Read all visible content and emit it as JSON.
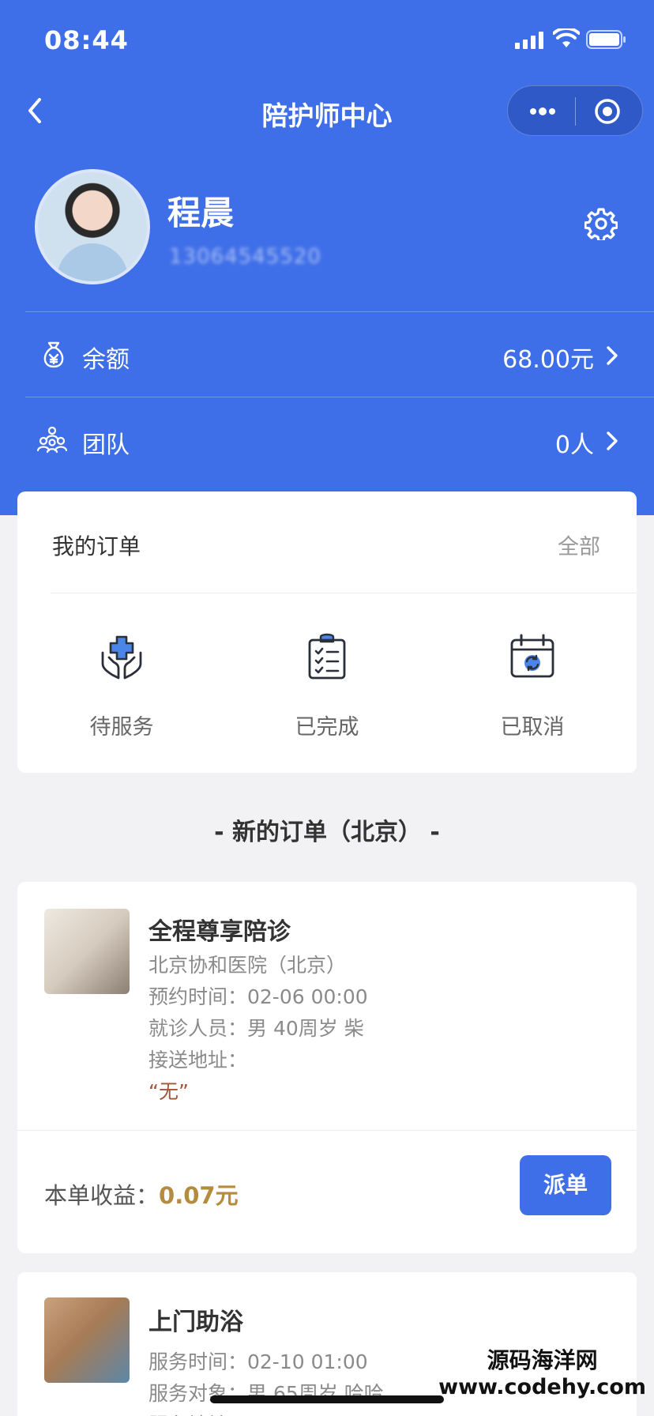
{
  "status_bar": {
    "time": "08:44"
  },
  "nav": {
    "title": "陪护师中心"
  },
  "profile": {
    "name": "程晨",
    "phone": "13064545520"
  },
  "rows": [
    {
      "icon": "money-bag-icon",
      "label": "余额",
      "value": "68.00元"
    },
    {
      "icon": "team-icon",
      "label": "团队",
      "value": "0人"
    }
  ],
  "my_orders": {
    "title": "我的订单",
    "all_label": "全部",
    "categories": [
      {
        "icon": "care-hands-icon",
        "label": "待服务"
      },
      {
        "icon": "clipboard-check-icon",
        "label": "已完成"
      },
      {
        "icon": "calendar-refresh-icon",
        "label": "已取消"
      }
    ]
  },
  "new_orders": {
    "section_title": "- 新的订单（北京） -",
    "orders": [
      {
        "title": "全程尊享陪诊",
        "lines": [
          "北京协和医院（北京）",
          "预约时间：02-06 00:00",
          "就诊人员：男 40周岁 柴",
          "接送地址："
        ],
        "quote": "“无”",
        "earn_label": "本单收益：",
        "earn_value": "0.07元",
        "button": "派单"
      },
      {
        "title": "上门助浴",
        "lines": [
          "服务时间：02-10 01:00",
          "服务对象：男 65周岁 哈哈",
          "服务地址："
        ]
      }
    ]
  },
  "watermark": {
    "line1": "源码海洋网",
    "line2": "www.codehy.com"
  },
  "colors": {
    "primary": "#3f6fe8",
    "earn": "#b58b3e",
    "quote": "#a0573a"
  }
}
